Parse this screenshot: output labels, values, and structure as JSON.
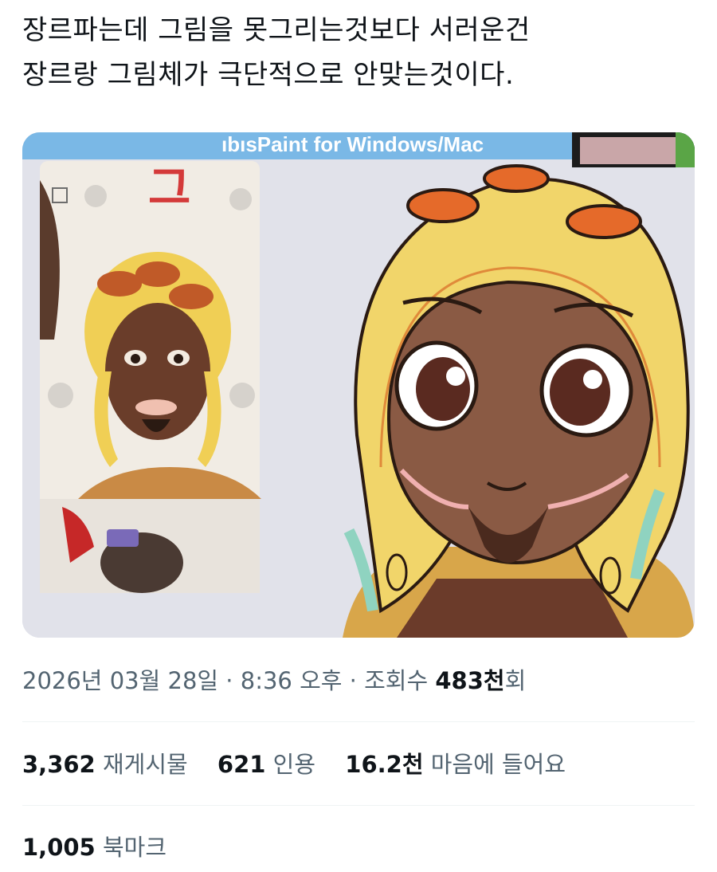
{
  "tweet": {
    "line1": "장르파는데 그림을 못그리는것보다 서러운건",
    "line2": "장르랑 그림체가 극단적으로 안맞는것이다."
  },
  "media": {
    "banner_text": "ıbısPaint for Windows/Mac",
    "ref_panel_char": "그"
  },
  "meta": {
    "date": "2026년 03월 28일",
    "sep1": " · ",
    "time": "8:36 오후",
    "sep2": " · ",
    "views_label": "조회수 ",
    "views_value": "483천",
    "views_suffix": "회"
  },
  "stats": {
    "reposts_count": "3,362",
    "reposts_label": "재게시물",
    "quotes_count": "621",
    "quotes_label": "인용",
    "likes_count": "16.2천",
    "likes_label": "마음에 들어요"
  },
  "bookmarks": {
    "count": "1,005",
    "label": "북마크"
  },
  "colors": {
    "text_primary": "#0f1419",
    "text_secondary": "#536471",
    "divider": "#eff3f4",
    "helmet_yellow": "#f1d56a",
    "skin_brown": "#8a5a44"
  }
}
